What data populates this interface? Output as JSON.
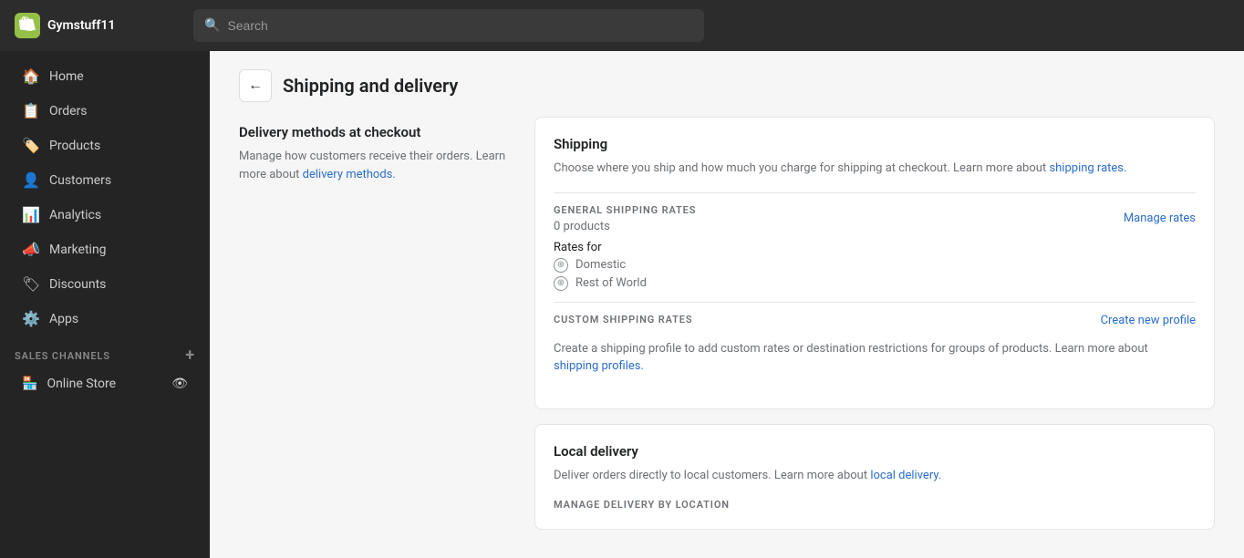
{
  "topbar": {
    "brand": "Gymstuff11",
    "logo_char": "S",
    "search_placeholder": "Search"
  },
  "sidebar": {
    "items": [
      {
        "id": "home",
        "label": "Home",
        "icon": "🏠"
      },
      {
        "id": "orders",
        "label": "Orders",
        "icon": "📋"
      },
      {
        "id": "products",
        "label": "Products",
        "icon": "🏷️"
      },
      {
        "id": "customers",
        "label": "Customers",
        "icon": "👤"
      },
      {
        "id": "analytics",
        "label": "Analytics",
        "icon": "📊"
      },
      {
        "id": "marketing",
        "label": "Marketing",
        "icon": "📣"
      },
      {
        "id": "discounts",
        "label": "Discounts",
        "icon": "🏷"
      },
      {
        "id": "apps",
        "label": "Apps",
        "icon": "⚙️"
      }
    ],
    "sales_channels_label": "SALES CHANNELS",
    "online_store_label": "Online Store",
    "add_channel_label": "+"
  },
  "page": {
    "back_label": "←",
    "title": "Shipping and delivery"
  },
  "delivery_methods": {
    "heading": "Delivery methods at checkout",
    "desc": "Manage how customers receive their orders. Learn more about",
    "link_text": "delivery methods.",
    "link_href": "#"
  },
  "shipping": {
    "title": "Shipping",
    "desc_prefix": "Choose where you ship and how much you charge for shipping at checkout. Learn more about",
    "link_text": "shipping rates.",
    "link_href": "#",
    "general_label": "GENERAL SHIPPING RATES",
    "products_count": "0 products",
    "manage_rates_label": "Manage rates",
    "rates_for_label": "Rates for",
    "rates": [
      {
        "id": "domestic",
        "label": "Domestic"
      },
      {
        "id": "rest-of-world",
        "label": "Rest of World"
      }
    ],
    "custom_label": "CUSTOM SHIPPING RATES",
    "create_profile_label": "Create new profile",
    "custom_desc_prefix": "Create a shipping profile to add custom rates or destination restrictions for groups of products. Learn more about",
    "custom_link_text": "shipping profiles.",
    "custom_link_href": "#"
  },
  "local_delivery": {
    "title": "Local delivery",
    "desc_prefix": "Deliver orders directly to local customers. Learn more about",
    "link_text": "local delivery.",
    "link_href": "#",
    "manage_label": "MANAGE DELIVERY BY LOCATION"
  }
}
